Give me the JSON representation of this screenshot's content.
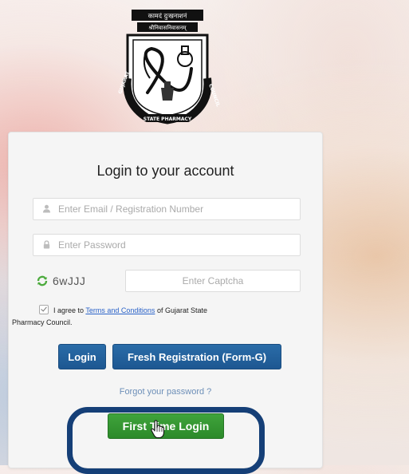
{
  "logo": {
    "banner_top": "कामदं दुःखनाशनं",
    "banner_second": "श्रीनिवासनिवासनम्",
    "ring_text_left": "GUJARAT",
    "ring_text_bottom": "STATE PHARMACY",
    "ring_text_right": "COUNCIL"
  },
  "form": {
    "title": "Login to your account",
    "email_placeholder": "Enter Email / Registration Number",
    "password_placeholder": "Enter Password",
    "captcha_value": "6wJJJ",
    "captcha_placeholder": "Enter Captcha",
    "agree_prefix": "I agree to",
    "terms_link": "Terms and Conditions",
    "agree_suffix": "of Gujarat State",
    "agree_tail": "Pharmacy Council.",
    "agree_checked": true,
    "login_label": "Login",
    "fresh_registration_label": "Fresh Registration (Form-G)",
    "forgot_password": "Forgot your password ?",
    "first_time_login_label": "First Time Login"
  },
  "colors": {
    "primary_blue": "#1d5791",
    "green": "#2c8a2a",
    "highlight_ring": "#153f77"
  }
}
